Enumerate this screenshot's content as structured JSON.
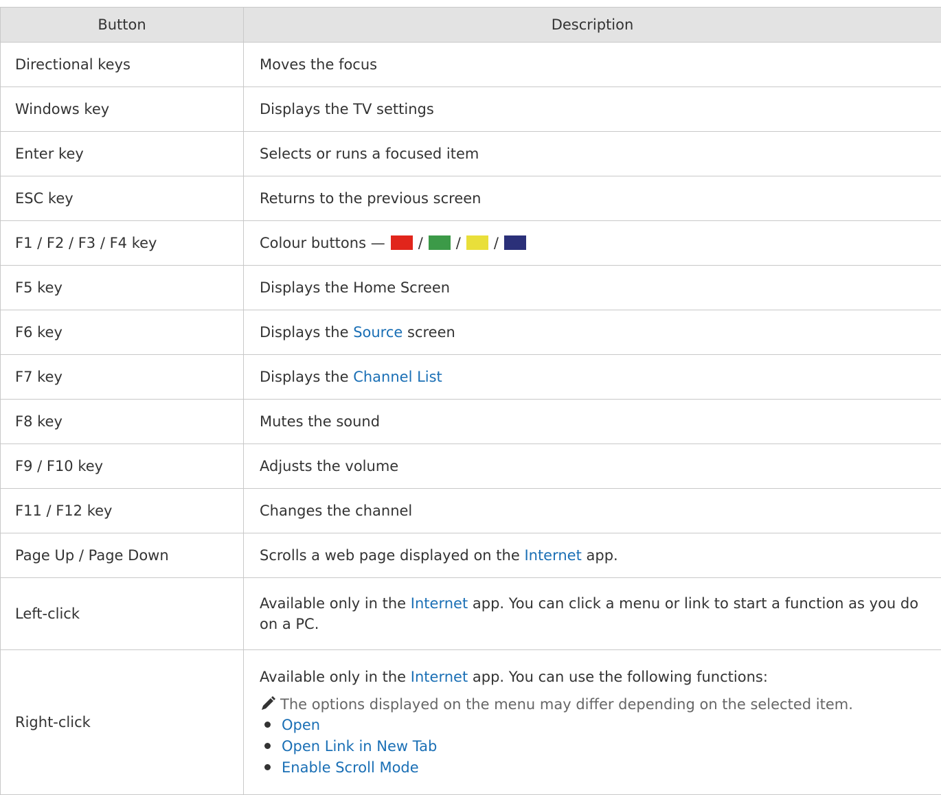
{
  "table": {
    "header": {
      "button": "Button",
      "description": "Description"
    },
    "rows": [
      {
        "button": "Directional keys",
        "desc": "Moves the focus"
      },
      {
        "button": "Windows key",
        "desc": "Displays the TV settings"
      },
      {
        "button": "Enter key",
        "desc": "Selects or runs a focused item"
      },
      {
        "button": "ESC key",
        "desc": "Returns to the previous screen"
      },
      {
        "button": "F1 / F2 / F3 / F4 key",
        "desc_prefix": "Colour buttons —",
        "sep": "/",
        "swatch_colors": [
          "#e1251b",
          "#3c9a48",
          "#e9df3a",
          "#2b3079"
        ]
      },
      {
        "button": "F5 key",
        "desc": "Displays the Home Screen"
      },
      {
        "button": "F6 key",
        "desc_a": "Displays the",
        "link": "Source",
        "desc_b": "screen"
      },
      {
        "button": "F7 key",
        "desc_a": "Displays the",
        "link": "Channel List"
      },
      {
        "button": "F8 key",
        "desc": "Mutes the sound"
      },
      {
        "button": "F9 / F10 key",
        "desc": "Adjusts the volume"
      },
      {
        "button": "F11 / F12 key",
        "desc": "Changes the channel"
      },
      {
        "button": "Page Up / Page Down",
        "desc_a": "Scrolls a web page displayed on the",
        "link": "Internet",
        "desc_b": "app."
      },
      {
        "button": "Left-click",
        "desc_a": "Available only in the",
        "link": "Internet",
        "desc_b": "app. You can click a menu or link to start a function as you do on a PC."
      },
      {
        "button": "Right-click",
        "desc_a": "Available only in the",
        "link": "Internet",
        "desc_b": "app. You can use the following functions:",
        "note": "The options displayed on the menu may differ depending on the selected item.",
        "options": [
          "Open",
          "Open Link in New Tab",
          "Enable Scroll Mode"
        ]
      }
    ]
  },
  "colors": {
    "link": "#1a6fb5",
    "header_bg": "#e3e3e3",
    "border": "#c8c8c8",
    "text": "#333333"
  },
  "icons": {
    "note": "pencil-icon",
    "bullet": "bullet-dot"
  }
}
